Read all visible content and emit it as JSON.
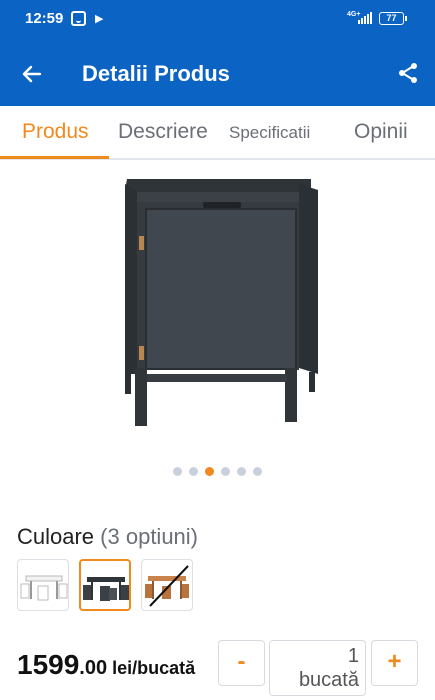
{
  "status_bar": {
    "time": "12:59",
    "network": "4G+",
    "battery": "77"
  },
  "header": {
    "title": "Detalii Produs"
  },
  "tabs": [
    {
      "label": "Produs",
      "active": true
    },
    {
      "label": "Descriere",
      "active": false
    },
    {
      "label": "Specificatii",
      "active": false
    },
    {
      "label": "Opinii",
      "active": false
    }
  ],
  "gallery": {
    "image_count": 6,
    "active_index": 2
  },
  "color": {
    "label": "Culoare",
    "count_text": "(3 optiuni)",
    "selected_index": 1
  },
  "price": {
    "integer": "1599",
    "decimal": ".00",
    "unit": " lei/bucată"
  },
  "quantity": {
    "minus": "-",
    "plus": "+",
    "value": "1",
    "unit": "bucată"
  },
  "colors": {
    "accent": "#f08a1c",
    "brand": "#0b63c4",
    "product": "#3a4046"
  }
}
